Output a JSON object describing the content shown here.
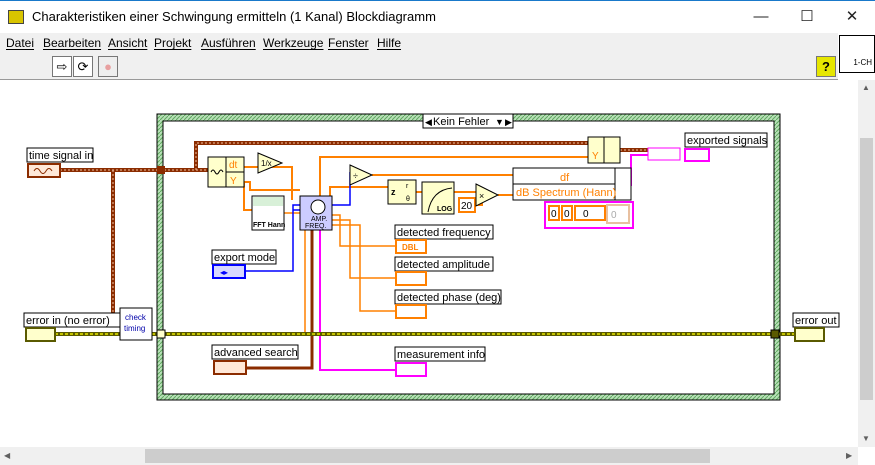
{
  "window": {
    "title": "Charakteristiken einer Schwingung ermitteln (1 Kanal) Blockdiagramm",
    "minimize": "—",
    "maximize": "☐",
    "close": "✕"
  },
  "menu": [
    "Datei",
    "Bearbeiten",
    "Ansicht",
    "Projekt",
    "Ausführen",
    "Werkzeuge",
    "Fenster",
    "Hilfe"
  ],
  "toolbar": {
    "run": "⇨",
    "run_continuous": "⟳",
    "abort": "●",
    "help": "?"
  },
  "vi_icon": {
    "label": "1-CH"
  },
  "case_selector": {
    "value": "Kein Fehler"
  },
  "terminals": {
    "time_signal_in": "time signal in",
    "error_in": "error in (no error)",
    "export_mode": "export mode",
    "advanced_search": "advanced search",
    "detected_frequency": "detected frequency",
    "detected_amplitude": "detected amplitude",
    "detected_phase": "detected phase (deg)",
    "measurement_info": "measurement info",
    "exported_signals": "exported signals",
    "error_out": "error out"
  },
  "nodes": {
    "unbundle_dt": "dt",
    "unbundle_y": "Y",
    "build_y": "Y",
    "fft_label": "FFT Hann",
    "amp_freq_top": "AMP.",
    "amp_freq_bottom": "FREQ.",
    "check_timing_1": "check",
    "check_timing_2": "timing",
    "bundle_df": "df",
    "bundle_spectrum": "dB Spectrum (Hann)",
    "constant_20": "20",
    "dbl": "DBL",
    "log_label": "LOG",
    "cluster_values": [
      "0",
      "0",
      "0",
      "0"
    ]
  },
  "colors": {
    "orange": "#ff8000",
    "brown": "#8b2c00",
    "blue": "#0000ff",
    "pink": "#ff00ff",
    "green_frame": "#5fa85f",
    "error_wire": "#5a5a00"
  }
}
